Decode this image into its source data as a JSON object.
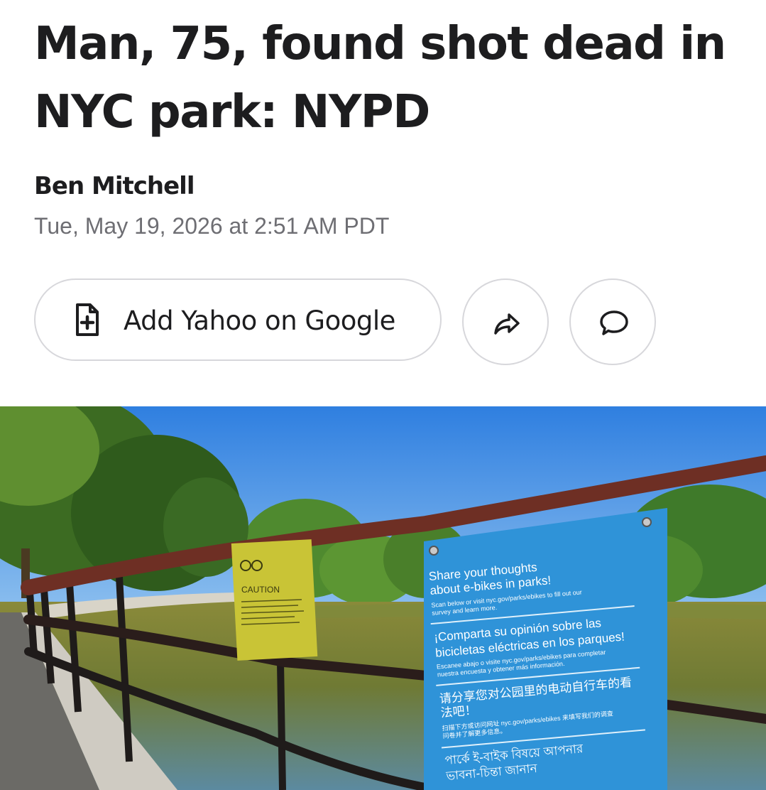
{
  "article": {
    "headline_line1": "Man, 75, found shot dead in",
    "headline_line2": "NYC park: NYPD",
    "author": "Ben Mitchell",
    "published": "Tue, May 19, 2026 at 2:51 AM PDT"
  },
  "actions": {
    "add_source_label": "Add Yahoo on Google",
    "add_source_icon": "document-plus-icon",
    "share_icon": "share-arrow-icon",
    "comment_icon": "speech-bubble-icon"
  },
  "photo": {
    "caution_sign_title": "CAUTION",
    "ebike_sign": {
      "en_title_1": "Share your thoughts",
      "en_title_2": "about e-bikes in parks!",
      "en_body_1": "Scan below or visit nyc.gov/parks/ebikes to fill out our",
      "en_body_2": "survey and learn more.",
      "es_title_1": "¡Comparta su opinión sobre las",
      "es_title_2": "bicicletas eléctricas en los parques!",
      "es_body_1": "Escanee abajo o visite nyc.gov/parks/ebikes para completar",
      "es_body_2": "nuestra encuesta y obtener más información.",
      "zh_title_1": "请分享您对公园里的电动自行车的看",
      "zh_title_2": "法吧！",
      "zh_body_1": "扫描下方或访问网址 nyc.gov/parks/ebikes 来填写我们的调查",
      "zh_body_2": "问卷并了解更多信息。",
      "bn_title_1": "পার্কে ই-বাইক বিষয়ে আপনার",
      "bn_title_2": "ভাবনা-চিন্তা জানান"
    }
  },
  "colors": {
    "text_primary": "#1d1d1f",
    "text_secondary": "#6e6e73",
    "button_border": "#d7d7db",
    "sky": "#3f86e0",
    "ebike_sign": "#2f93d8",
    "caution_sign": "#c9c436",
    "railing": "#6e2f24"
  }
}
